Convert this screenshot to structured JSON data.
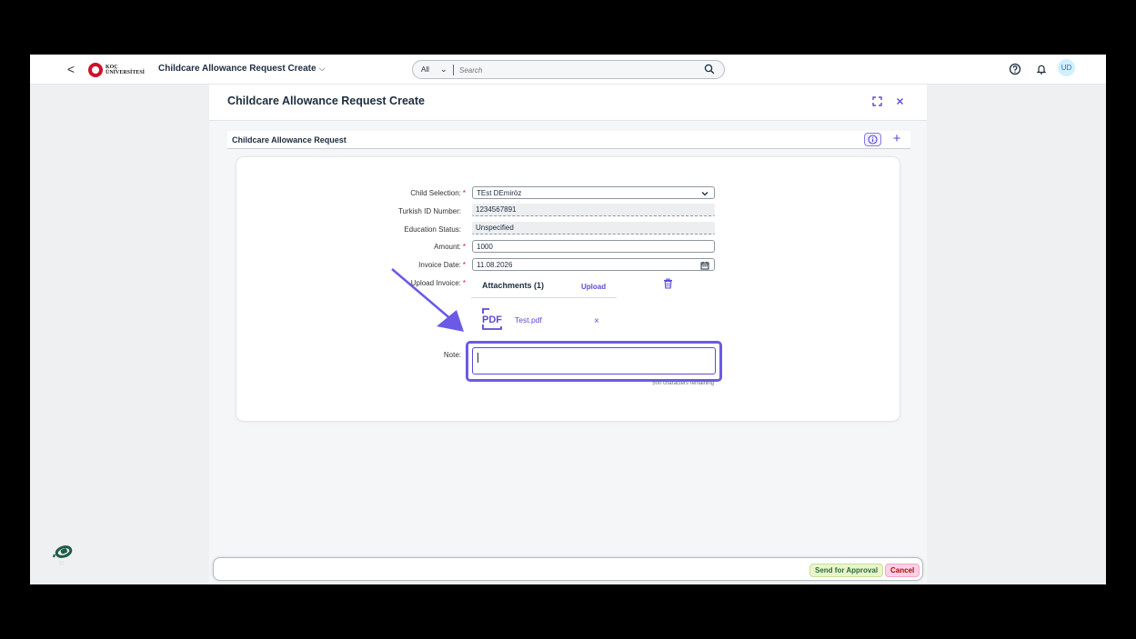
{
  "shell": {
    "back_glyph": "<",
    "logo_line1": "KOÇ",
    "logo_line2": "ÜNİVERSİTESİ",
    "app_title": "Childcare Allowance Request Create",
    "app_title_chevron": "⌵",
    "search_scope": "All",
    "search_scope_chevron": "⌄",
    "search_placeholder": "Search",
    "avatar_initials": "UD"
  },
  "page": {
    "title": "Childcare Allowance Request Create"
  },
  "section": {
    "title": "Childcare Allowance Request",
    "plus_glyph": "+"
  },
  "form": {
    "child_selection": {
      "label": "Child Selection:",
      "value": "TEst DEmiröz",
      "required": "*"
    },
    "turkish_id": {
      "label": "Turkish ID Number:",
      "value": "1234567891"
    },
    "education_status": {
      "label": "Education Status:",
      "value": "Unspecified"
    },
    "amount": {
      "label": "Amount:",
      "value": "1000",
      "required": "*"
    },
    "invoice_date": {
      "label": "Invoice Date:",
      "value": "11.08.2026",
      "required": "*"
    },
    "upload_invoice": {
      "label": "Upload Invoice:",
      "required": "*"
    },
    "attachments": {
      "title": "Attachments (1)",
      "upload_label": "Upload",
      "file_name": "Test.pdf",
      "remove_glyph": "×",
      "pdf_badge": "PDF"
    },
    "note": {
      "label": "Note:",
      "value": "",
      "counter": "500 characters remaining"
    }
  },
  "footer": {
    "send_label": "Send for Approval",
    "cancel_label": "Cancel"
  },
  "colors": {
    "accent": "#5b4bd8",
    "highlight": "#6b5ae6",
    "required": "#d0112b",
    "send_bg": "#ebf5cb",
    "cancel_bg": "#ffd0e7"
  },
  "icons": {
    "search": "search-icon",
    "help": "help-icon",
    "bell": "bell-icon",
    "fullscreen": "fullscreen-icon",
    "close": "close-icon",
    "info": "info-icon",
    "calendar": "calendar-icon",
    "trash": "trash-icon",
    "pdf": "pdf-file-icon"
  }
}
